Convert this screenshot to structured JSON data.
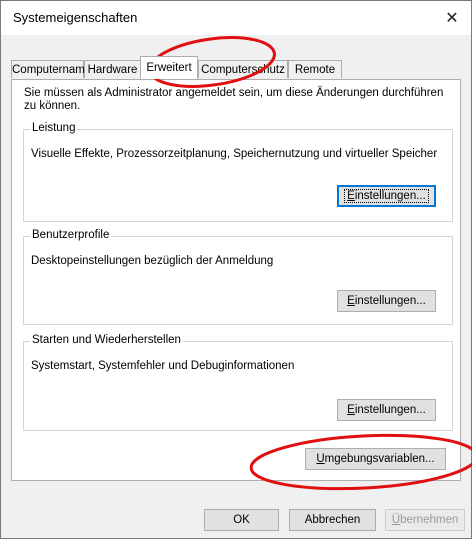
{
  "window": {
    "title": "Systemeigenschaften",
    "close_glyph": "✕"
  },
  "tabs": [
    {
      "label": "Computername"
    },
    {
      "label": "Hardware"
    },
    {
      "label": "Erweitert"
    },
    {
      "label": "Computerschutz"
    },
    {
      "label": "Remote"
    }
  ],
  "advanced": {
    "notice": "Sie müssen als Administrator angemeldet sein, um diese Änderungen durchführen zu können.",
    "performance": {
      "title": "Leistung",
      "description": "Visuelle Effekte, Prozessorzeitplanung, Speichernutzung und virtueller Speicher",
      "button": {
        "mnemonic": "E",
        "rest": "instellungen..."
      }
    },
    "profiles": {
      "title": "Benutzerprofile",
      "description": "Desktopeinstellungen bezüglich der Anmeldung",
      "button": {
        "mnemonic": "E",
        "rest": "instellungen..."
      }
    },
    "startup": {
      "title": "Starten und Wiederherstellen",
      "description": "Systemstart, Systemfehler und Debuginformationen",
      "button": {
        "mnemonic": "E",
        "rest": "instellungen..."
      }
    },
    "env_button": {
      "mnemonic": "U",
      "rest": "mgebungsvariablen..."
    }
  },
  "footer": {
    "ok": "OK",
    "cancel": "Abbrechen",
    "apply": {
      "mnemonic": "Ü",
      "rest": "bernehmen"
    }
  },
  "annotation_color": "#e01010"
}
